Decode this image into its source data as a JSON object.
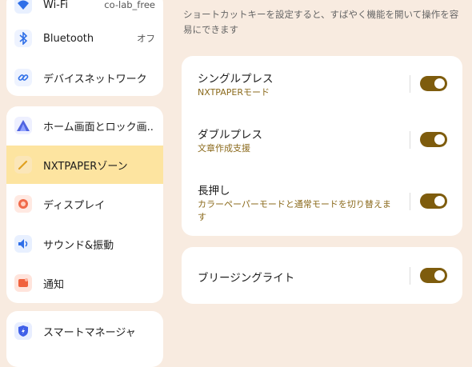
{
  "sidebar": {
    "group1": [
      {
        "label": "Wi-Fi",
        "value": "co-lab_free",
        "icon": "wifi-icon"
      },
      {
        "label": "Bluetooth",
        "value": "オフ",
        "icon": "bluetooth-icon"
      },
      {
        "label": "デバイスネットワーク",
        "value": "",
        "icon": "link-icon"
      }
    ],
    "group2": [
      {
        "label": "ホーム画面とロック画..",
        "icon": "home-screen-icon"
      },
      {
        "label": "NXTPAPERゾーン",
        "icon": "pencil-icon"
      },
      {
        "label": "ディスプレイ",
        "icon": "display-icon"
      },
      {
        "label": "サウンド&振動",
        "icon": "speaker-icon"
      },
      {
        "label": "通知",
        "icon": "notification-icon"
      }
    ],
    "group3": [
      {
        "label": "スマートマネージャ",
        "icon": "shield-bolt-icon"
      }
    ]
  },
  "main": {
    "description": "ショートカットキーを設定すると、すばやく機能を開いて操作を容易にできます",
    "shortcuts": [
      {
        "title": "シングルプレス",
        "subtitle": "NXTPAPERモード",
        "enabled": true
      },
      {
        "title": "ダブルプレス",
        "subtitle": "文章作成支援",
        "enabled": true
      },
      {
        "title": "長押し",
        "subtitle": "カラーペーパーモードと通常モードを切り替えます",
        "enabled": true
      }
    ],
    "breathing_light": {
      "title": "ブリージングライト",
      "enabled": true
    }
  },
  "colors": {
    "background": "#f8ebe0",
    "active_item": "#fde4a0",
    "toggle_on": "#7e5c0d",
    "subtitle": "#8b6a1c"
  }
}
